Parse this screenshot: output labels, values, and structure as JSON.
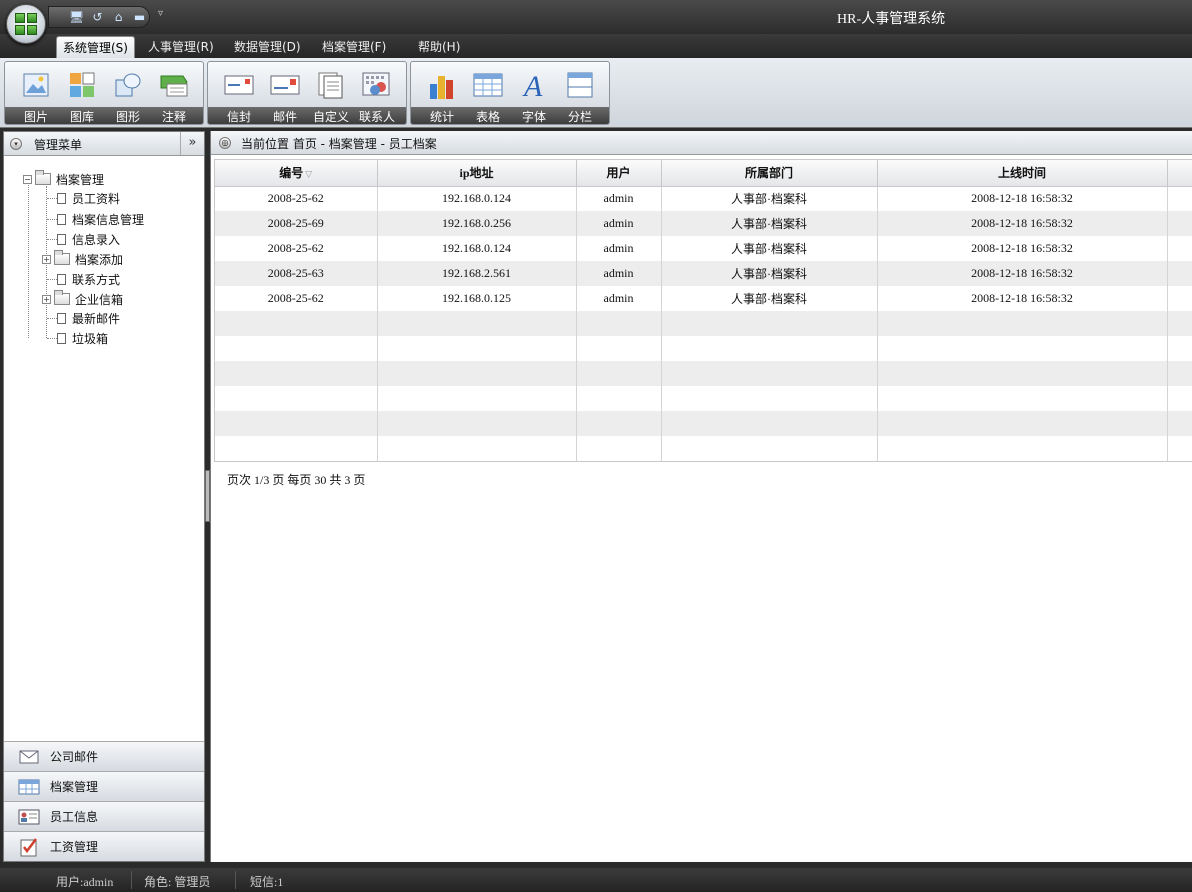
{
  "app": {
    "title": "HR-人事管理系统"
  },
  "menu": {
    "tabs": [
      {
        "label": "系统管理(S)"
      },
      {
        "label": "人事管理(R)"
      },
      {
        "label": "数据管理(D)"
      },
      {
        "label": "档案管理(F)"
      },
      {
        "label": "帮助(H)"
      }
    ],
    "active_index": 0
  },
  "ribbon": {
    "groups": [
      {
        "buttons": [
          {
            "label": "图片",
            "icon": "picture-icon"
          },
          {
            "label": "图库",
            "icon": "gallery-icon"
          },
          {
            "label": "图形",
            "icon": "shapes-icon"
          },
          {
            "label": "注释",
            "icon": "annotation-icon"
          }
        ]
      },
      {
        "buttons": [
          {
            "label": "信封",
            "icon": "envelope-icon"
          },
          {
            "label": "邮件",
            "icon": "mail-icon"
          },
          {
            "label": "自定义",
            "icon": "custom-icon"
          },
          {
            "label": "联系人",
            "icon": "contacts-icon"
          }
        ]
      },
      {
        "buttons": [
          {
            "label": "统计",
            "icon": "statistics-icon"
          },
          {
            "label": "表格",
            "icon": "table-icon"
          },
          {
            "label": "字体",
            "icon": "font-icon"
          },
          {
            "label": "分栏",
            "icon": "columns-icon"
          }
        ]
      }
    ]
  },
  "left_panel": {
    "title": "管理菜单",
    "collapse_glyph": "»",
    "tree": {
      "root": "档案管理",
      "children": [
        "员工资料",
        "档案信息管理",
        "信息录入",
        "档案添加",
        "联系方式",
        "企业信箱",
        "最新邮件",
        "垃圾箱"
      ]
    },
    "sections": [
      {
        "label": "公司邮件",
        "icon": "mail-icon"
      },
      {
        "label": "档案管理",
        "icon": "table-icon"
      },
      {
        "label": "员工信息",
        "icon": "id-card-icon"
      },
      {
        "label": "工资管理",
        "icon": "checklist-icon"
      }
    ]
  },
  "content": {
    "breadcrumb": "当前位置 首页 - 档案管理 - 员工档案",
    "table": {
      "columns": [
        "编号",
        "ip地址",
        "用户",
        "所属部门",
        "上线时间"
      ],
      "rows": [
        [
          "2008-25-62",
          "192.168.0.124",
          "admin",
          "人事部·档案科",
          "2008-12-18 16:58:32"
        ],
        [
          "2008-25-69",
          "192.168.0.256",
          "admin",
          "人事部·档案科",
          "2008-12-18 16:58:32"
        ],
        [
          "2008-25-62",
          "192.168.0.124",
          "admin",
          "人事部·档案科",
          "2008-12-18 16:58:32"
        ],
        [
          "2008-25-63",
          "192.168.2.561",
          "admin",
          "人事部·档案科",
          "2008-12-18 16:58:32"
        ],
        [
          "2008-25-62",
          "192.168.0.125",
          "admin",
          "人事部·档案科",
          "2008-12-18 16:58:32"
        ]
      ]
    },
    "pager": "页次 1/3 页 每页 30 共 3 页"
  },
  "status": {
    "user": "用户:admin",
    "role": "角色: 管理员",
    "sms": "短信:1"
  },
  "colors": {
    "chrome_dark": "#2b2b2b",
    "ribbon_light": "#e9edf1",
    "row_alt": "#ededed"
  }
}
